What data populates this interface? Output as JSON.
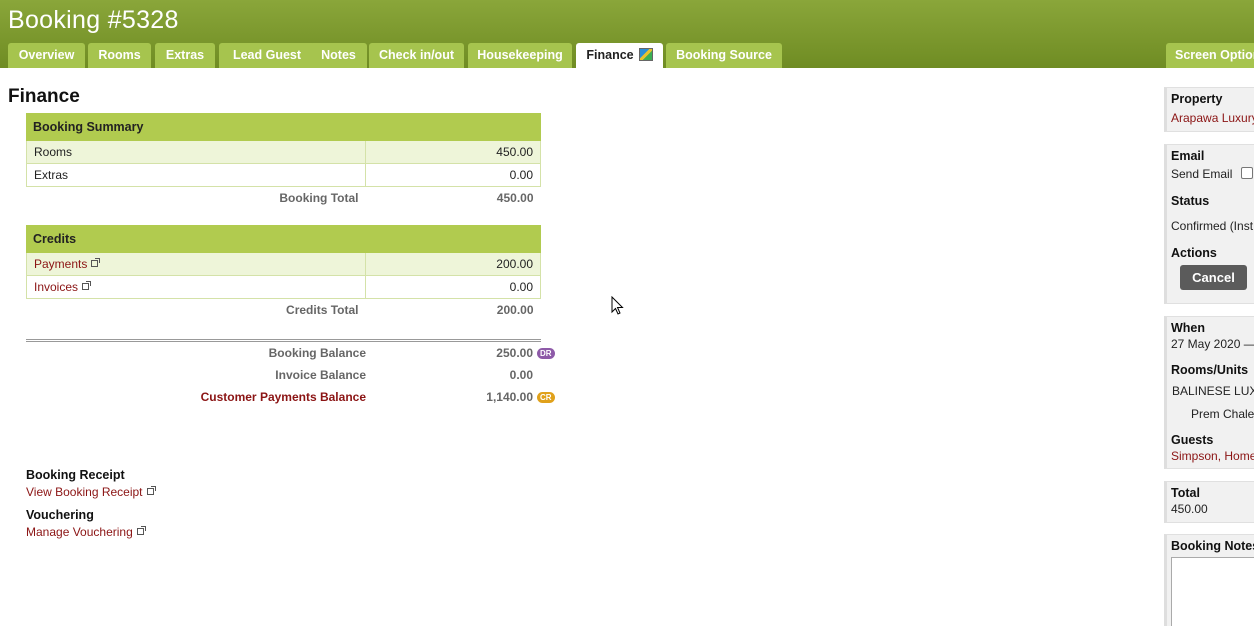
{
  "header": {
    "title": "Booking #5328",
    "tabs": [
      {
        "label": "Overview"
      },
      {
        "label": "Rooms"
      },
      {
        "label": "Extras"
      },
      {
        "label": "Lead Guest"
      },
      {
        "label": "Notes"
      },
      {
        "label": "Check in/out"
      },
      {
        "label": "Housekeeping"
      },
      {
        "label": "Finance",
        "active": true
      },
      {
        "label": "Booking Source"
      }
    ],
    "screen_options": "Screen Options"
  },
  "main": {
    "title": "Finance",
    "summary": {
      "heading": "Booking Summary",
      "rows": [
        {
          "label": "Rooms",
          "value": "450.00"
        },
        {
          "label": "Extras",
          "value": "0.00"
        }
      ],
      "total_label": "Booking Total",
      "total_value": "450.00"
    },
    "credits": {
      "heading": "Credits",
      "rows": [
        {
          "label": "Payments",
          "value": "200.00"
        },
        {
          "label": "Invoices",
          "value": "0.00"
        }
      ],
      "total_label": "Credits Total",
      "total_value": "200.00"
    },
    "balances": {
      "booking_label": "Booking Balance",
      "booking_value": "250.00",
      "booking_badge": "DR",
      "invoice_label": "Invoice Balance",
      "invoice_value": "0.00",
      "customer_label": "Customer Payments Balance",
      "customer_value": "1,140.00",
      "customer_badge": "CR"
    },
    "receipt": {
      "heading": "Booking Receipt",
      "link": "View Booking Receipt"
    },
    "vouchering": {
      "heading": "Vouchering",
      "link": "Manage Vouchering"
    }
  },
  "sidebar": {
    "property_heading": "Property",
    "property_value": "Arapawa Luxury",
    "email_heading": "Email",
    "send_email": "Send Email",
    "status_heading": "Status",
    "status_value": "Confirmed (Inst",
    "actions_heading": "Actions",
    "cancel_label": "Cancel",
    "when_heading": "When",
    "when_value": "27 May 2020 —",
    "rooms_heading": "Rooms/Units",
    "room_line1": "BALINESE LUX",
    "room_line2": "Prem Chale",
    "guests_heading": "Guests",
    "guests_value": "Simpson, Home",
    "total_heading": "Total",
    "total_value": "450.00",
    "notes_heading": "Booking Notes"
  },
  "colors": {
    "header_green": "#7a9630",
    "tab_green": "#a6c44e",
    "table_head": "#b1cb4f",
    "link_red": "#8b1414",
    "badge_dr": "#8e5aa8",
    "badge_cr": "#e0a11b"
  }
}
